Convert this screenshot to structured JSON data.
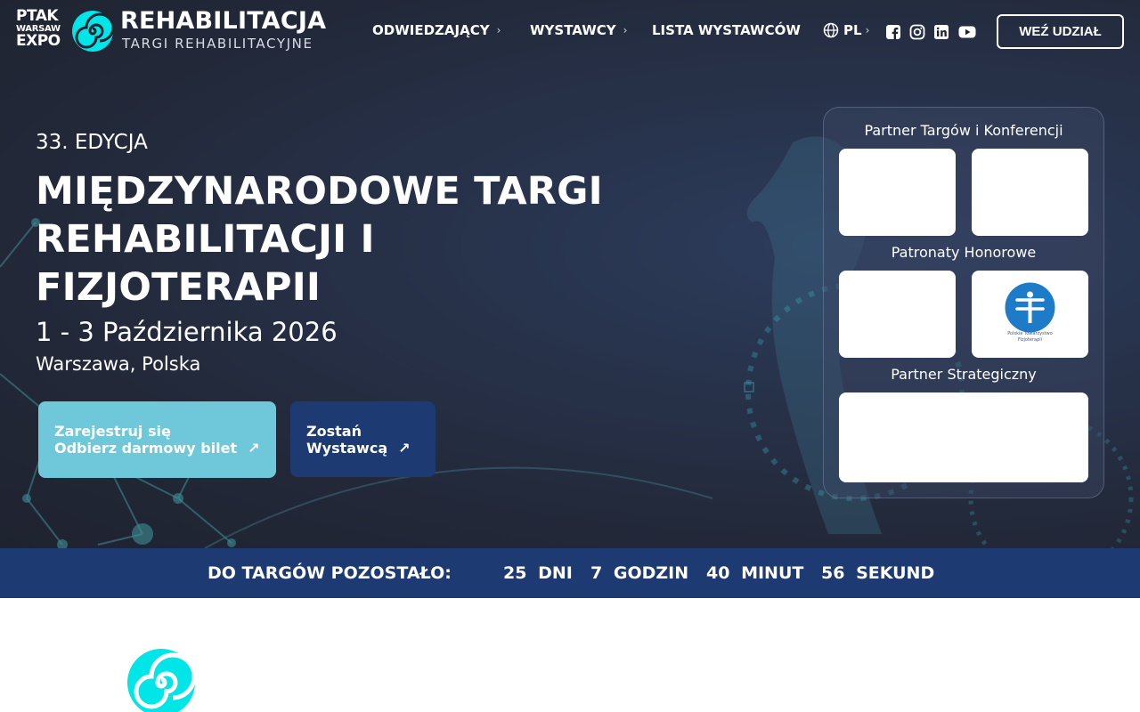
{
  "header": {
    "logo": {
      "line1": "PTAK",
      "line2": "WARSAW",
      "line3": "EXPO",
      "title": "REHABILITACJA",
      "subtitle": "TARGI REHABILITACYJNE"
    },
    "nav": [
      {
        "label": "ODWIEDZAJĄCY",
        "has_submenu": true
      },
      {
        "label": "WYSTAWCY",
        "has_submenu": true
      },
      {
        "label": "LISTA WYSTAWCÓW",
        "has_submenu": false
      }
    ],
    "language": "PL",
    "social_icons": [
      "facebook-icon",
      "instagram-icon",
      "linkedin-icon",
      "youtube-icon"
    ],
    "cta_label": "WEŹ UDZIAŁ"
  },
  "hero": {
    "edition": "33. EDYCJA",
    "headline_lines": [
      "MIĘDZYNARODOWE TARGI",
      "REHABILITACJI I",
      "FIZJOTERAPII"
    ],
    "dates": "1 - 3 Października 2026",
    "location": "Warszawa, Polska",
    "register_button": {
      "line1": "Zarejestruj się",
      "line2": "Odbierz darmowy bilet"
    },
    "exhibitor_button": {
      "line1": "Zostań",
      "line2": "Wystawcą"
    }
  },
  "partners": {
    "conference_partner_heading": "Partner Targów i Konferencji",
    "honorary_heading": "Patronaty Honorowe",
    "strategic_heading": "Partner Strategiczny",
    "honorary_logo_caption_1": "Polskie Towarzystwo",
    "honorary_logo_caption_2": "Fizjoterapii"
  },
  "countdown": {
    "label": "DO TARGÓW POZOSTAŁO:",
    "days": "25",
    "days_unit": "DNI",
    "hours": "7",
    "hours_unit": "GODZIN",
    "minutes": "40",
    "minutes_unit": "MINUT",
    "seconds": "56",
    "seconds_unit": "SEKUND"
  },
  "colors": {
    "hero_bg": "#222838",
    "accent_cyan": "#6ec8da",
    "navy": "#1e3a72",
    "swirl": "#00e5e8"
  }
}
